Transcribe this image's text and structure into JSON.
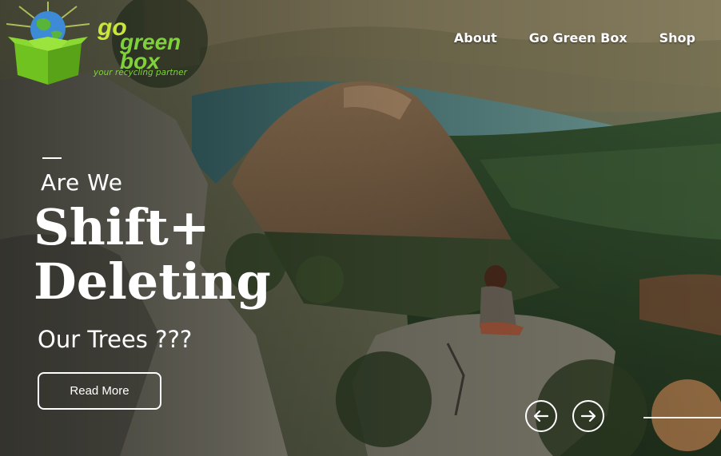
{
  "brand": {
    "logo_text": "go green box",
    "tagline": "your recycling partner"
  },
  "nav": {
    "items": [
      {
        "label": "About"
      },
      {
        "label": "Go Green Box"
      },
      {
        "label": "Shop"
      }
    ]
  },
  "hero": {
    "eyebrow": "Are We",
    "headline_line1": "Shift+",
    "headline_line2": "Deleting",
    "subline": "Our Trees ???",
    "cta_label": "Read More"
  },
  "slider": {
    "prev_icon": "arrow-left-icon",
    "next_icon": "arrow-right-icon"
  },
  "colors": {
    "brand_green": "#7fd13b",
    "text": "#ffffff"
  }
}
